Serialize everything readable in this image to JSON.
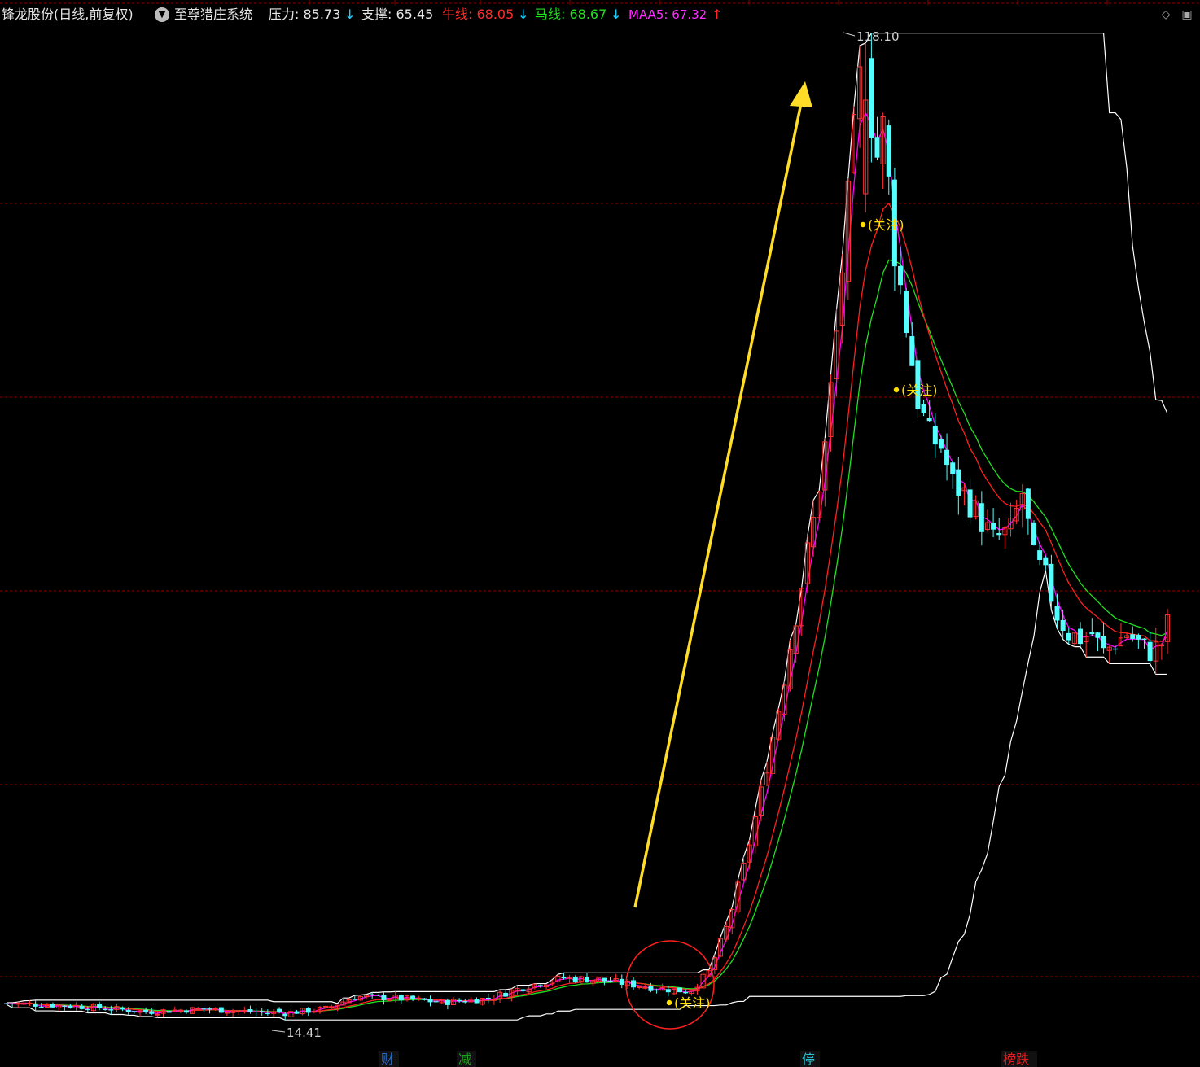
{
  "header": {
    "title": "锋龙股份(日线,前复权)",
    "indicator_icon": "chevron-circle-icon",
    "indicator_name": "至尊猎庄系统",
    "pressure_label": "压力: 85.73",
    "pressure_arrow": "↓",
    "support_label": "支撑: 65.45",
    "bull_label": "牛线: 68.05",
    "bull_arrow": "↓",
    "horse_label": "马线: 68.67",
    "horse_arrow": "↓",
    "maa5_label": "MAA5: 67.32",
    "maa5_arrow": "↑",
    "icons": [
      "diamond-icon",
      "window-restore-icon"
    ]
  },
  "colors": {
    "background": "#000000",
    "grid": "#8b0000",
    "up_candle": "#ff3232",
    "down_candle": "#54ffff",
    "bull_line": "#ff2020",
    "horse_line": "#20e020",
    "maa5_line": "#ff00ff",
    "channel": "#ffffff",
    "arrow": "#ffdc28",
    "circle": "#ff2020",
    "note": "#ffe000"
  },
  "chart_data": {
    "type": "candlestick",
    "ylim": [
      11,
      124
    ],
    "grid": "dashed horizontal",
    "max_label": "118.10",
    "min_label": "14.41",
    "notes": [
      "(关注)",
      "(关注)",
      "(关注)"
    ],
    "markers": [
      {
        "text": "财",
        "color": "#2a6fd6"
      },
      {
        "text": "减",
        "color": "#1ea01e"
      },
      {
        "text": "停",
        "color": "#26c6da"
      },
      {
        "text": "榜跌",
        "color": "#e02020"
      }
    ]
  }
}
